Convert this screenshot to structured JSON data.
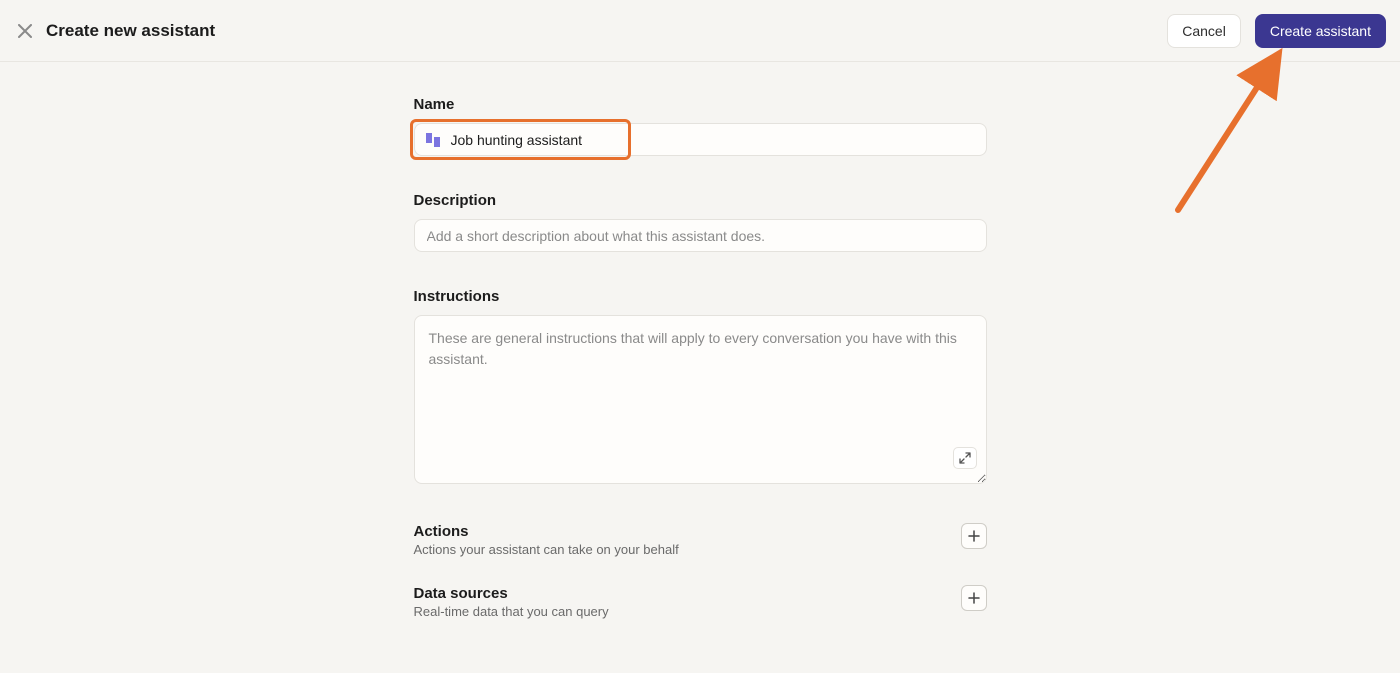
{
  "header": {
    "title": "Create new assistant",
    "cancel_label": "Cancel",
    "create_label": "Create assistant"
  },
  "form": {
    "name": {
      "label": "Name",
      "value": "Job hunting assistant",
      "icon": "assistant-avatar-icon"
    },
    "description": {
      "label": "Description",
      "placeholder": "Add a short description about what this assistant does."
    },
    "instructions": {
      "label": "Instructions",
      "placeholder": "These are general instructions that will apply to every conversation you have with this assistant."
    },
    "actions": {
      "label": "Actions",
      "sublabel": "Actions your assistant can take on your behalf"
    },
    "data_sources": {
      "label": "Data sources",
      "sublabel": "Real-time data that you can query"
    }
  },
  "annotations": {
    "highlight_name_field": true,
    "arrow_pointing_to_create_button": true,
    "arrow_color": "#e7702d"
  }
}
